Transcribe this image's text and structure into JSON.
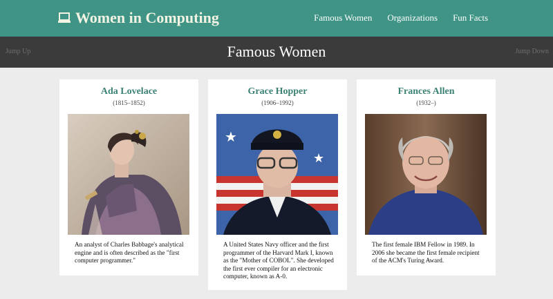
{
  "site": {
    "title": "Women in Computing",
    "nav": [
      {
        "label": "Famous Women"
      },
      {
        "label": "Organizations"
      },
      {
        "label": "Fun Facts"
      }
    ]
  },
  "section": {
    "title": "Famous Women",
    "jump_up": "Jump Up",
    "jump_down": "Jump Down"
  },
  "cards": [
    {
      "name": "Ada Lovelace",
      "years": "(1815–1852)",
      "description": "An analyst of Charles Babbage's analytical engine and is often described as the \"first computer programmer.\""
    },
    {
      "name": "Grace Hopper",
      "years": "(1906–1992)",
      "description": "A United States Navy officer and the first programmer of the Harvard Mark I, known as the \"Mother of COBOL\". She developed the first ever compiler for an electronic computer, known as A-0."
    },
    {
      "name": "Frances Allen",
      "years": "(1932–)",
      "description": "The first female IBM Fellow in 1989. In 2006 she became the first female recipient of the ACM's Turing Award."
    }
  ],
  "colors": {
    "header_teal": "#3f9486",
    "section_bar": "#3b3b3b",
    "name_teal": "#3c8274",
    "page_bg": "#ececec"
  }
}
